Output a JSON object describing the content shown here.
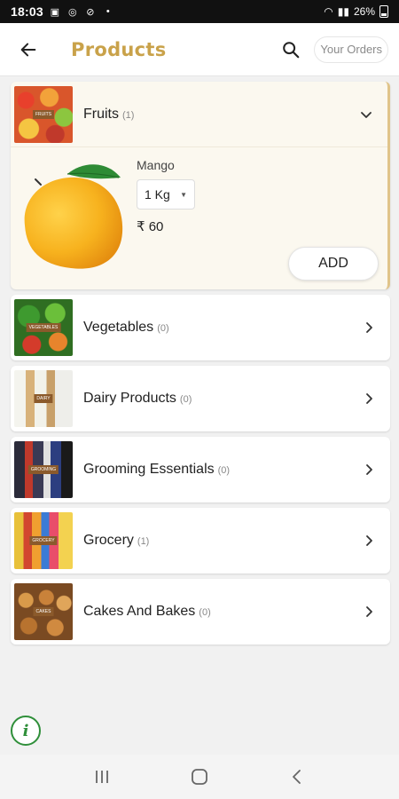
{
  "status_bar": {
    "time": "18:03",
    "battery": "26%"
  },
  "app_bar": {
    "title": "Products",
    "orders_label": "Your Orders"
  },
  "categories": [
    {
      "name": "Fruits",
      "count": "(1)",
      "expanded": true
    },
    {
      "name": "Vegetables",
      "count": "(0)"
    },
    {
      "name": "Dairy Products",
      "count": "(0)"
    },
    {
      "name": "Grooming Essentials",
      "count": "(0)"
    },
    {
      "name": "Grocery",
      "count": "(1)"
    },
    {
      "name": "Cakes And Bakes",
      "count": "(0)"
    }
  ],
  "product": {
    "name": "Mango",
    "quantity": "1 Kg",
    "price": "₹ 60",
    "add_label": "ADD"
  },
  "colors": {
    "title": "#c9a24a",
    "expanded_bg": "#fbf8ef",
    "expanded_accent": "#e0c48a",
    "info": "#2f8f3a"
  },
  "info_icon": "i"
}
